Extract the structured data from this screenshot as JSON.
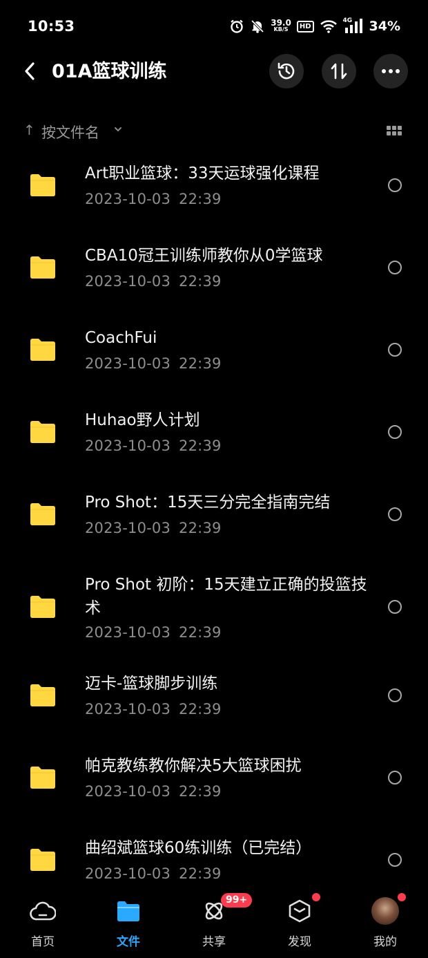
{
  "status_bar": {
    "time": "10:53",
    "net_speed_value": "39.0",
    "net_speed_unit": "KB/S",
    "hd": "HD",
    "network": "4G",
    "battery": "34%"
  },
  "header": {
    "title": "01A篮球训练"
  },
  "sort": {
    "label": "按文件名"
  },
  "files": [
    {
      "name": "Art职业篮球：33天运球强化课程",
      "date": "2023-10-03",
      "time": "22:39"
    },
    {
      "name": "CBA10冠王训练师教你从0学篮球",
      "date": "2023-10-03",
      "time": "22:39"
    },
    {
      "name": "CoachFui",
      "date": "2023-10-03",
      "time": "22:39"
    },
    {
      "name": "Huhao野人计划",
      "date": "2023-10-03",
      "time": "22:39"
    },
    {
      "name": "Pro Shot：15天三分完全指南完结",
      "date": "2023-10-03",
      "time": "22:39"
    },
    {
      "name": "Pro Shot 初阶：15天建立正确的投篮技术",
      "date": "2023-10-03",
      "time": "22:39"
    },
    {
      "name": "迈卡-篮球脚步训练",
      "date": "2023-10-03",
      "time": "22:39"
    },
    {
      "name": "帕克教练教你解决5大篮球困扰",
      "date": "2023-10-03",
      "time": "22:39"
    },
    {
      "name": "曲绍斌篮球60练训练（已完结）",
      "date": "2023-10-03",
      "time": "22:39"
    }
  ],
  "bottom_nav": {
    "items": [
      {
        "label": "首页",
        "icon": "cloud-home-icon"
      },
      {
        "label": "文件",
        "icon": "folder-icon",
        "active": true
      },
      {
        "label": "共享",
        "icon": "share-atom-icon",
        "badge": "99+"
      },
      {
        "label": "发现",
        "icon": "discover-box-icon"
      },
      {
        "label": "我的",
        "icon": "avatar"
      }
    ]
  },
  "colors": {
    "accent": "#2aa7ff",
    "folder": "#ffd740",
    "badge": "#ff3b4e",
    "background": "#000000"
  }
}
